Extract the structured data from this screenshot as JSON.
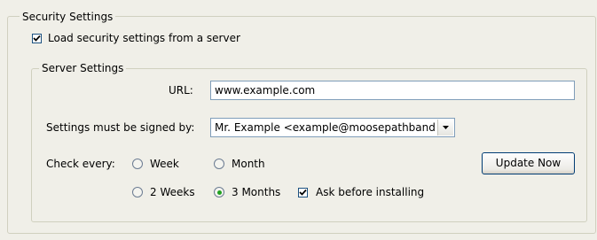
{
  "security_group": {
    "legend": "Security Settings",
    "load_from_server": {
      "label": "Load security settings from a server",
      "checked": true
    }
  },
  "server_group": {
    "legend": "Server Settings",
    "url": {
      "label": "URL:",
      "value": "www.example.com"
    },
    "signed_by": {
      "label": "Settings must be signed by:",
      "value": "Mr. Example <example@moosepathbandb.cc"
    },
    "check_every": {
      "label": "Check every:",
      "options": [
        {
          "label": "Week",
          "checked": false
        },
        {
          "label": "Month",
          "checked": false
        },
        {
          "label": "2 Weeks",
          "checked": false
        },
        {
          "label": "3 Months",
          "checked": true
        }
      ]
    },
    "ask_before_installing": {
      "label": "Ask before installing",
      "checked": true
    },
    "update_now_label": "Update Now"
  },
  "icons": {
    "check": "checkmark-icon",
    "dropdown": "chevron-down-icon"
  },
  "colors": {
    "background": "#f0efe8",
    "radio_selected": "#21a121",
    "input_border": "#7f9db9"
  }
}
